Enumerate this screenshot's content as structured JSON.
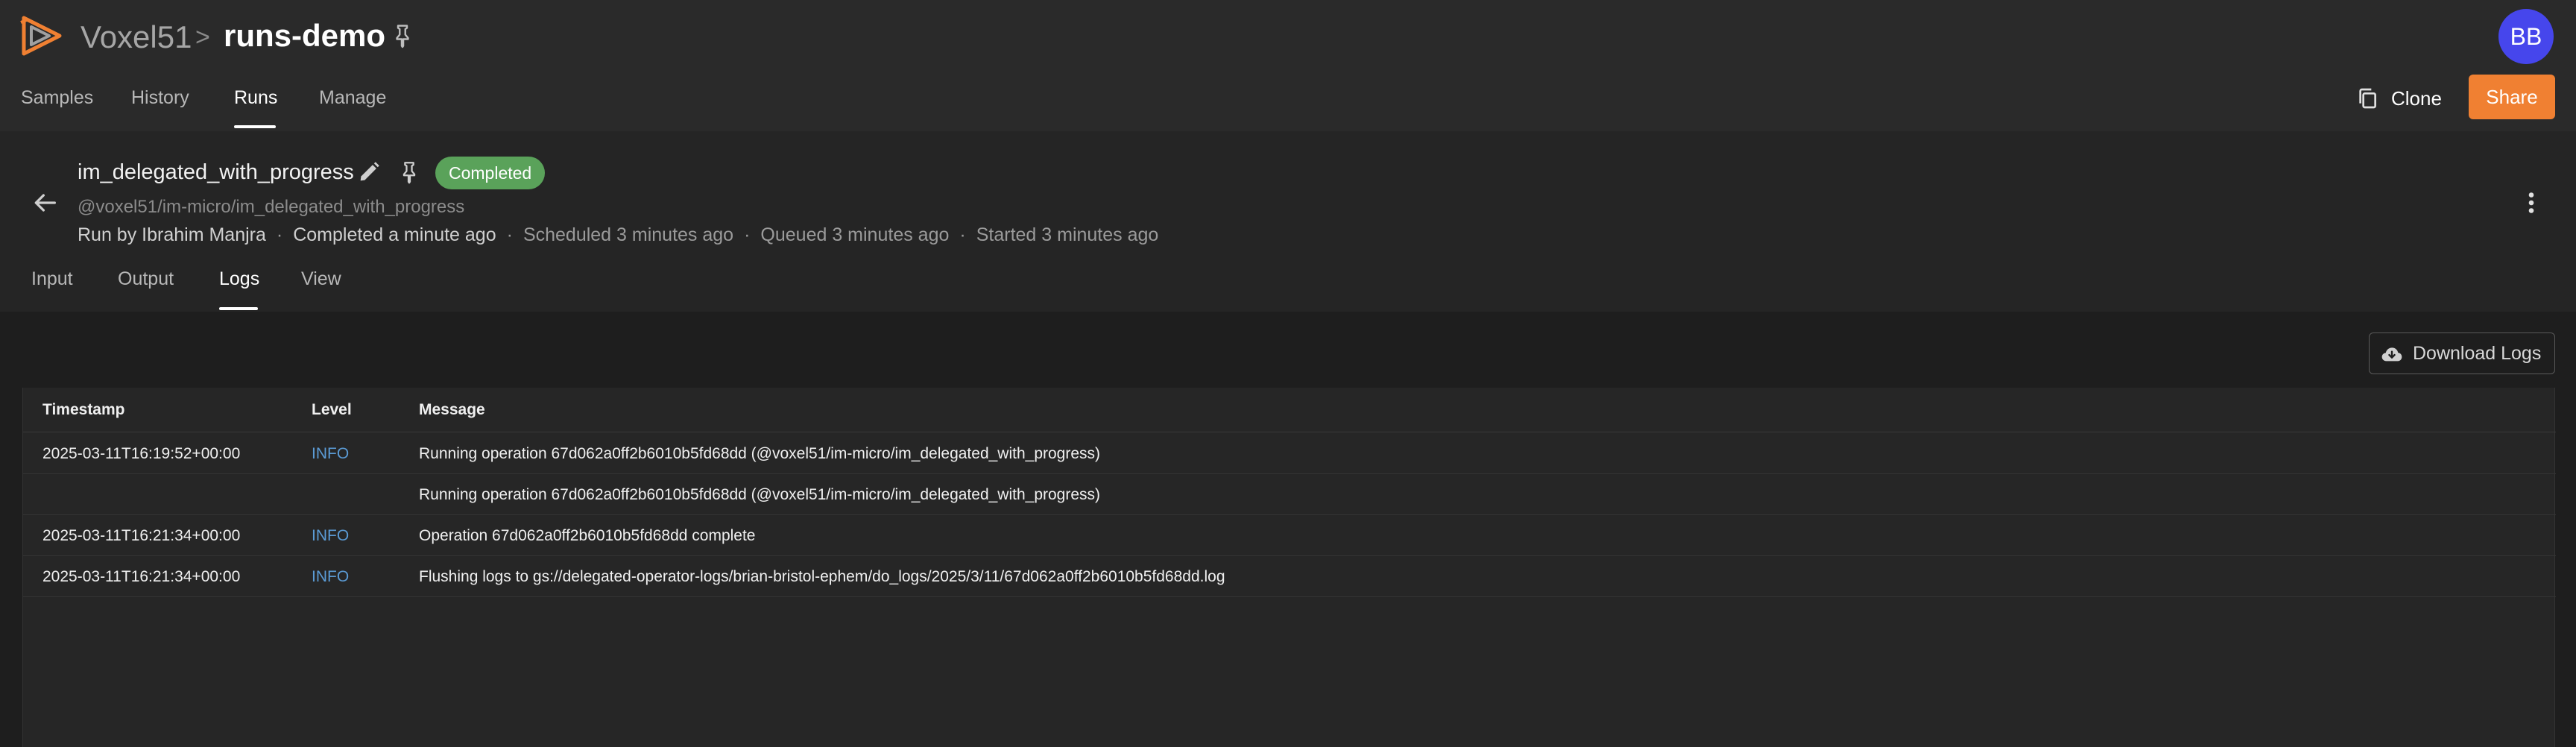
{
  "app": {
    "brand": "Voxel51",
    "breadcrumb_sep": ">",
    "dataset": "runs-demo",
    "avatar_initials": "BB",
    "avatar_color": "#4646ec"
  },
  "nav": {
    "tabs": [
      "Samples",
      "History",
      "Runs",
      "Manage"
    ],
    "active": "Runs"
  },
  "actions": {
    "clone_label": "Clone",
    "share_label": "Share",
    "share_color": "#f08032"
  },
  "run": {
    "name": "im_delegated_with_progress",
    "status": "Completed",
    "status_color": "#5aa25a",
    "path": "@voxel51/im-micro/im_delegated_with_progress",
    "meta": {
      "run_by": "Run by Ibrahim Manjra",
      "completed": "Completed a minute ago",
      "scheduled": "Scheduled 3 minutes ago",
      "queued": "Queued 3 minutes ago",
      "started": "Started 3 minutes ago"
    },
    "tabs": [
      "Input",
      "Output",
      "Logs",
      "View"
    ],
    "active_tab": "Logs"
  },
  "logs": {
    "download_label": "Download Logs",
    "columns": [
      "Timestamp",
      "Level",
      "Message"
    ],
    "rows": [
      {
        "timestamp": "2025-03-11T16:19:52+00:00",
        "level": "INFO",
        "message": "Running operation 67d062a0ff2b6010b5fd68dd (@voxel51/im-micro/im_delegated_with_progress)"
      },
      {
        "timestamp": "",
        "level": "",
        "message": "Running operation 67d062a0ff2b6010b5fd68dd (@voxel51/im-micro/im_delegated_with_progress)"
      },
      {
        "timestamp": "2025-03-11T16:21:34+00:00",
        "level": "INFO",
        "message": "Operation 67d062a0ff2b6010b5fd68dd complete"
      },
      {
        "timestamp": "2025-03-11T16:21:34+00:00",
        "level": "INFO",
        "message": "Flushing logs to gs://delegated-operator-logs/brian-bristol-ephem/do_logs/2025/3/11/67d062a0ff2b6010b5fd68dd.log"
      }
    ],
    "level_color": "#5b9bd5"
  }
}
